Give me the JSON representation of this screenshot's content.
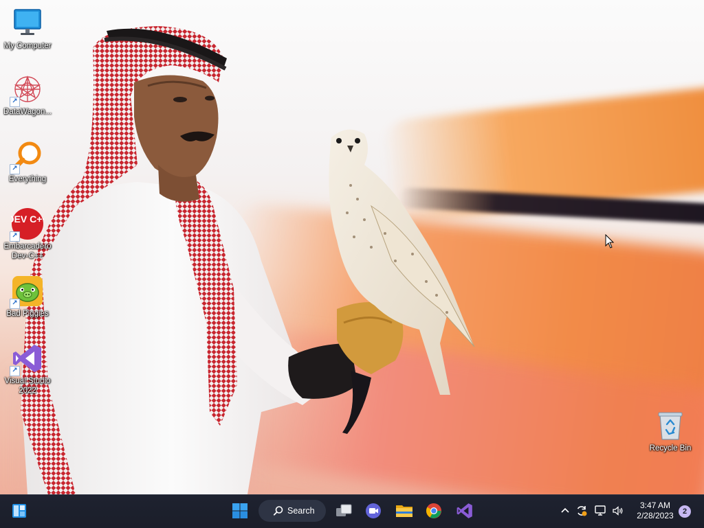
{
  "desktop": {
    "icons": [
      {
        "label": "My Computer"
      },
      {
        "label": "DataWagon..."
      },
      {
        "label": "Everything"
      },
      {
        "label": "Embarcadero Dev-C++",
        "icon_text": "DEV C++"
      },
      {
        "label": "Bad Piggies"
      },
      {
        "label": "Visual Studio 2022"
      }
    ],
    "recycle_bin": {
      "label": "Recycle Bin"
    }
  },
  "taskbar": {
    "search_label": "Search",
    "pinned": [
      "windows-start-icon",
      "task-view-icon",
      "meet-icon",
      "file-explorer-icon",
      "chrome-icon",
      "visual-studio-icon"
    ]
  },
  "tray": {
    "time": "3:47 AM",
    "date": "2/28/2023",
    "notifications": "2"
  },
  "colors": {
    "taskbar_bg": "#1b1e29",
    "accent_blue": "#3a8fe8",
    "badge": "#c7b8f2"
  }
}
